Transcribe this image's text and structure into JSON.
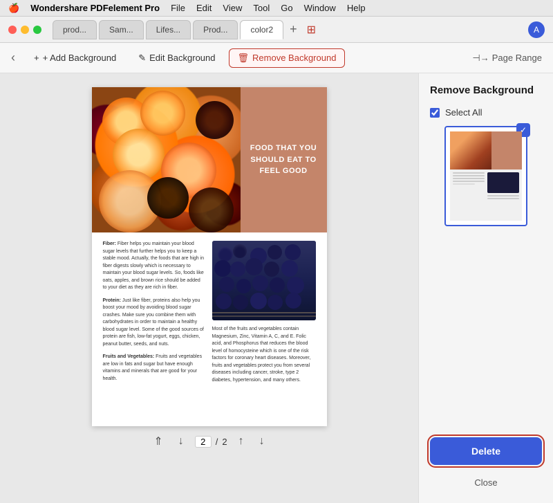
{
  "menubar": {
    "apple": "🍎",
    "app_name": "Wondershare PDFelement Pro",
    "items": [
      "File",
      "Edit",
      "View",
      "Tool",
      "Go",
      "Window",
      "Help"
    ]
  },
  "titlebar": {
    "tabs": [
      {
        "label": "prod...",
        "active": false
      },
      {
        "label": "Sam...",
        "active": false
      },
      {
        "label": "Lifes...",
        "active": false
      },
      {
        "label": "Prod...",
        "active": false
      },
      {
        "label": "color2",
        "active": true
      }
    ],
    "add_tab": "+",
    "avatar_letter": "A"
  },
  "toolbar": {
    "back_icon": "‹",
    "add_background": "+ Add Background",
    "edit_background": "✎ Edit Background",
    "remove_background": "🗑 Remove Background",
    "page_range": "⊣→ Page Range"
  },
  "right_panel": {
    "title": "Remove Background",
    "select_all_label": "Select All",
    "delete_label": "Delete",
    "close_label": "Close"
  },
  "pagination": {
    "current_page": "2",
    "total_pages": "2",
    "separator": "/"
  },
  "pdf_content": {
    "title_line1": "FOOD THAT YOU",
    "title_line2": "SHOULD EAT TO",
    "title_line3": "FEEL GOOD",
    "fiber_heading": "Fiber:",
    "fiber_text": "Fiber helps you maintain your blood sugar levels that further helps you to keep a stable mood. Actually, the foods that are high in fiber digests slowly which is necessary to maintain your blood sugar levels. So, foods like oats, apples, and brown rice should be added to your diet as they are rich in fiber.",
    "protein_heading": "Protein:",
    "protein_text": "Just like fiber, proteins also help you boost your mood by avoiding blood sugar crashes. Make sure you combine them with carbohydrates in order to maintain a healthy blood sugar level. Some of the good sources of protein are fish, low-fat yogurt, eggs, chicken, peanut butter, seeds, and nuts.",
    "fruits_heading": "Fruits and Vegetables:",
    "fruits_text": "Fruits and vegetables are low in fats and sugar but have enough vitamins and minerals that are good for your health.",
    "right_text": "Most of the fruits and vegetables contain Magnesium, Zinc, Vitamin A, C, and E. Folic acid, and Phosphorus that reduces the blood level of homocysteine which is one of the risk factors for coronary heart diseases. Moreover, fruits and vegetables protect you from several diseases including cancer, stroke, type 2 diabetes, hypertension, and many others."
  },
  "colors": {
    "accent_blue": "#3a5bd9",
    "accent_red": "#c0392b",
    "title_box_bg": "#c4856a",
    "delete_btn_bg": "#3a5bd9"
  }
}
